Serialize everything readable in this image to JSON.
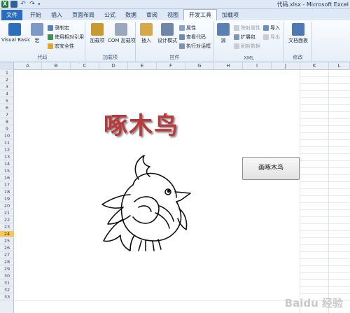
{
  "window": {
    "title": "代码.xlsx - Microsoft Excel",
    "qat_icons": [
      "excel-icon",
      "save-icon",
      "undo-icon",
      "redo-icon",
      "customize-icon"
    ]
  },
  "tabs": [
    {
      "label": "文件",
      "kind": "file"
    },
    {
      "label": "开始"
    },
    {
      "label": "插入"
    },
    {
      "label": "页面布局"
    },
    {
      "label": "公式"
    },
    {
      "label": "数据"
    },
    {
      "label": "审阅"
    },
    {
      "label": "视图"
    },
    {
      "label": "开发工具",
      "active": true
    },
    {
      "label": "加载项"
    }
  ],
  "ribbon": {
    "code": {
      "label": "代码",
      "visual_basic": "Visual Basic",
      "macro": "宏",
      "record_macro": "录制宏",
      "relative_ref": "使用相对引用",
      "macro_security": "宏安全性"
    },
    "addins": {
      "label": "加载项",
      "addins": "加载项",
      "com_addins": "COM 加载项"
    },
    "controls": {
      "label": "控件",
      "insert": "插入",
      "design_mode": "设计模式",
      "properties": "属性",
      "view_code": "查看代码",
      "run_dialog": "执行对话框"
    },
    "xml": {
      "label": "XML",
      "source": "源",
      "map_properties": "映射属性",
      "expansion_packs": "扩展包",
      "refresh_data": "刷新数据",
      "import": "导入",
      "export": "导出"
    },
    "modify": {
      "label": "修改",
      "document_panel": "文档面板"
    }
  },
  "sheet": {
    "columns": [
      "A",
      "B",
      "C",
      "D",
      "E",
      "F",
      "G",
      "H",
      "I",
      "J",
      "K",
      "L"
    ],
    "rows": [
      "1",
      "2",
      "3",
      "4",
      "5",
      "6",
      "7",
      "8",
      "9",
      "10",
      "11",
      "12",
      "13",
      "14",
      "15",
      "16",
      "17",
      "18",
      "19",
      "20",
      "21",
      "22",
      "23",
      "24",
      "25",
      "26",
      "27",
      "28",
      "29",
      "30",
      "31",
      "32",
      "33"
    ],
    "selected_row": "24"
  },
  "content": {
    "title_wordart": "啄木鸟",
    "draw_button": "画啄木鸟"
  },
  "watermark": "Baidu 经验",
  "colors": {
    "file_tab": "#2a6cc1",
    "wordart": "#b83a3a",
    "selected_row": "#f6c75a"
  }
}
